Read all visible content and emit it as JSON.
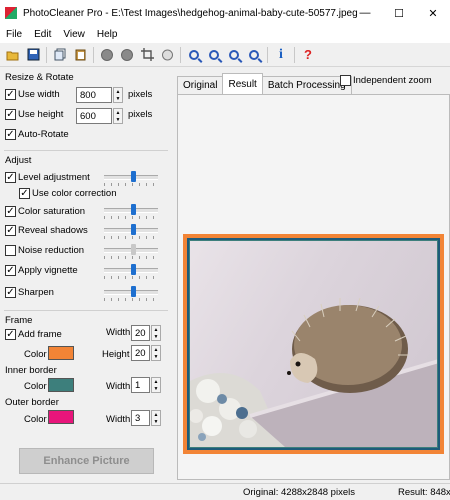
{
  "window": {
    "title": "PhotoCleaner Pro - E:\\Test Images\\hedgehog-animal-baby-cute-50577.jpeg",
    "minimize_glyph": "—",
    "maximize_glyph": "☐",
    "close_glyph": "✕"
  },
  "menu": [
    "File",
    "Edit",
    "View",
    "Help"
  ],
  "toolbar": {
    "icons": [
      "open-icon",
      "save-icon",
      "copy-icon",
      "paste-icon",
      "undo-icon",
      "redo-icon",
      "crop-icon",
      "hand-icon",
      "zoom-in-icon",
      "zoom-out-icon",
      "zoom-fit-icon",
      "zoom-actual-icon",
      "info-icon",
      "help-icon"
    ],
    "info_glyph": "i",
    "help_glyph": "?"
  },
  "resize": {
    "title": "Resize & Rotate",
    "use_width": {
      "label": "Use width",
      "checked": true,
      "value": "800",
      "unit": "pixels"
    },
    "use_height": {
      "label": "Use height",
      "checked": true,
      "value": "600",
      "unit": "pixels"
    },
    "auto_rotate": {
      "label": "Auto-Rotate",
      "checked": true
    }
  },
  "adjust": {
    "title": "Adjust",
    "level_adjustment": {
      "label": "Level adjustment",
      "checked": true,
      "level": 0.5
    },
    "use_color_correction": {
      "label": "Use color correction",
      "checked": true
    },
    "color_saturation": {
      "label": "Color saturation",
      "checked": true,
      "level": 0.5
    },
    "reveal_shadows": {
      "label": "Reveal shadows",
      "checked": true,
      "level": 0.5
    },
    "noise_reduction": {
      "label": "Noise reduction",
      "checked": false,
      "level": 0.5
    },
    "apply_vignette": {
      "label": "Apply vignette",
      "checked": true,
      "level": 0.5
    },
    "sharpen": {
      "label": "Sharpen",
      "checked": true,
      "level": 0.5
    }
  },
  "frame": {
    "title": "Frame",
    "add_frame": {
      "label": "Add frame",
      "checked": true
    },
    "width_label": "Width",
    "width_value": "20",
    "color_label": "Color",
    "color": "#f28436",
    "height_label": "Height",
    "height_value": "20"
  },
  "inner_border": {
    "title": "Inner border",
    "color_label": "Color",
    "color": "#3d7f7c",
    "width_label": "Width",
    "width_value": "1"
  },
  "outer_border": {
    "title": "Outer border",
    "color_label": "Color",
    "color": "#e8157b",
    "width_label": "Width",
    "width_value": "3"
  },
  "enhance_button": "Enhance Picture",
  "tabs": [
    "Original",
    "Result",
    "Batch Processing"
  ],
  "active_tab": "Result",
  "independent_zoom": {
    "label": "Independent zoom",
    "checked": false
  },
  "status": {
    "original": "Original: 4288x2848 pixels",
    "result": "Result: 848x"
  }
}
